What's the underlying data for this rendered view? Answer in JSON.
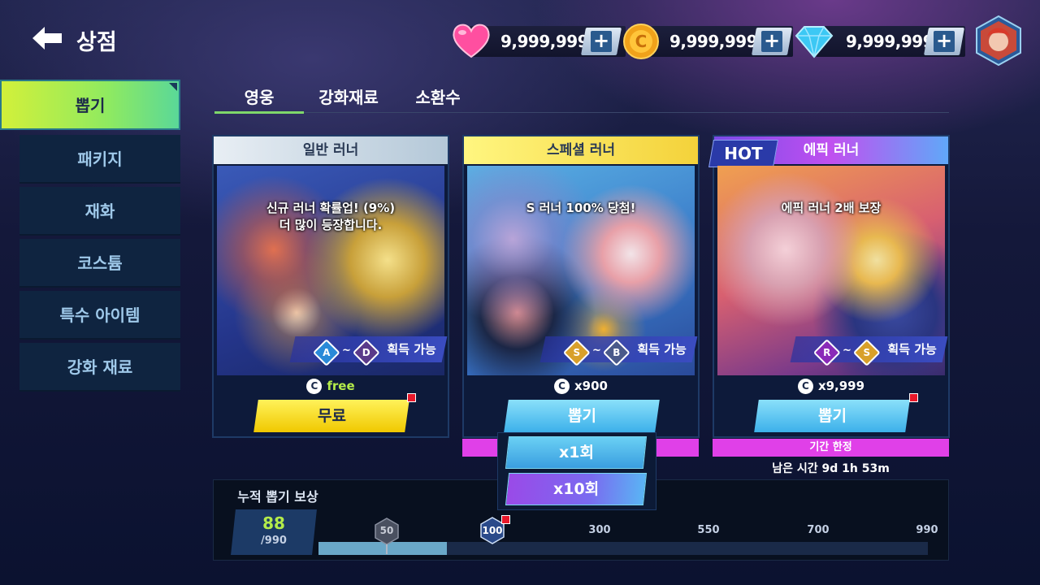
{
  "header": {
    "title": "상점",
    "hearts": "9,999,999",
    "coins": "9,999,999",
    "gems": "9,999,999",
    "plus": "+"
  },
  "sidebar": {
    "items": [
      {
        "label": "뽑기"
      },
      {
        "label": "패키지"
      },
      {
        "label": "재화"
      },
      {
        "label": "코스튬"
      },
      {
        "label": "특수 아이템"
      },
      {
        "label": "강화 재료"
      }
    ]
  },
  "tabs": [
    {
      "label": "영웅"
    },
    {
      "label": "강화재료"
    },
    {
      "label": "소환수"
    }
  ],
  "cards": [
    {
      "title": "일반 러너",
      "message1": "신규 러너 확률업! (9%)",
      "message2": "더 많이 등장합니다.",
      "grade_from": "A",
      "sep": "~",
      "grade_to": "D",
      "obtain": "획득 가능",
      "coin_glyph": "C",
      "cost": "free",
      "button": "무료"
    },
    {
      "title": "스페셜 러너",
      "message1": "S 러너 100% 당첨!",
      "grade_from": "S",
      "sep": "~",
      "grade_to": "B",
      "obtain": "획득 가능",
      "coin_glyph": "C",
      "cost": "x900",
      "button": "뽑기"
    },
    {
      "title": "에픽 러너",
      "hot": "HOT",
      "message1": "에픽 러너 2배 보장",
      "grade_from": "R",
      "sep": "~",
      "grade_to": "S",
      "obtain": "획득 가능",
      "coin_glyph": "C",
      "cost": "x9,999",
      "button": "뽑기",
      "limited": "기간 한정",
      "remaining": "남은 시간 9d 1h 53m"
    }
  ],
  "popup": {
    "x1": "x1회",
    "x10": "x10회"
  },
  "reward": {
    "title": "누적 뽑기 보상",
    "current": "88",
    "total": "/990",
    "progress_ratio": 0.21,
    "milestones": [
      "50",
      "100",
      "300",
      "550",
      "700",
      "990"
    ]
  },
  "colors": {
    "accent_green": "#8fea60",
    "magenta": "#e040e8",
    "cyan_button": "#5cc8f0",
    "yellow_button": "#f4e23a"
  }
}
